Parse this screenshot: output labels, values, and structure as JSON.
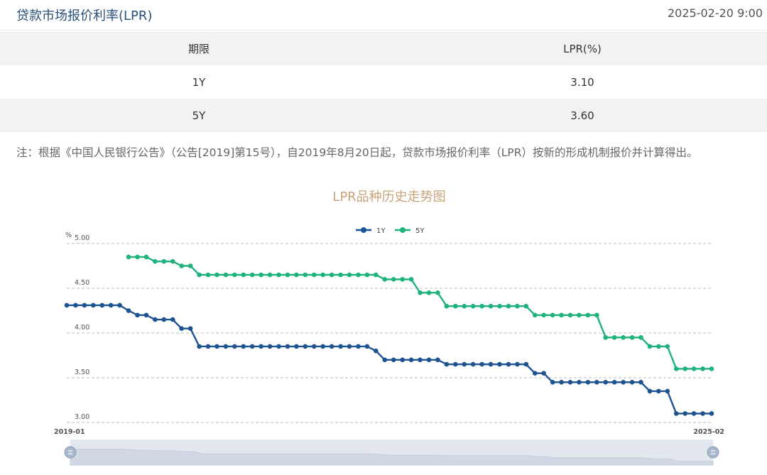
{
  "header": {
    "title": "贷款市场报价利率(LPR)",
    "date": "2025-02-20 9:00"
  },
  "table": {
    "columns": [
      "期限",
      "LPR(%)"
    ],
    "rows": [
      {
        "term": "1Y",
        "value": "3.10"
      },
      {
        "term": "5Y",
        "value": "3.60"
      }
    ]
  },
  "note": "注：根据《中国人民银行公告》（公告[2019]第15号），自2019年8月20日起，贷款市场报价利率（LPR）按新的形成机制报价并计算得出。",
  "chart_data": {
    "type": "line",
    "title": "LPR品种历史走势图",
    "ylabel": "%",
    "ylim": [
      3.0,
      5.0
    ],
    "yticks": [
      "5.00",
      "4.50",
      "4.00",
      "3.50",
      "3.00"
    ],
    "x_start_label": "2019-01",
    "x_end_label": "2025-02",
    "legend_position": "top-center",
    "grid": true,
    "series": [
      {
        "name": "1Y",
        "color": "#1d5390",
        "values": [
          4.31,
          4.31,
          4.31,
          4.31,
          4.31,
          4.31,
          4.31,
          4.25,
          4.2,
          4.2,
          4.15,
          4.15,
          4.15,
          4.05,
          4.05,
          3.85,
          3.85,
          3.85,
          3.85,
          3.85,
          3.85,
          3.85,
          3.85,
          3.85,
          3.85,
          3.85,
          3.85,
          3.85,
          3.85,
          3.85,
          3.85,
          3.85,
          3.85,
          3.85,
          3.85,
          3.8,
          3.7,
          3.7,
          3.7,
          3.7,
          3.7,
          3.7,
          3.7,
          3.65,
          3.65,
          3.65,
          3.65,
          3.65,
          3.65,
          3.65,
          3.65,
          3.65,
          3.65,
          3.55,
          3.55,
          3.45,
          3.45,
          3.45,
          3.45,
          3.45,
          3.45,
          3.45,
          3.45,
          3.45,
          3.45,
          3.45,
          3.35,
          3.35,
          3.35,
          3.1,
          3.1,
          3.1,
          3.1,
          3.1
        ]
      },
      {
        "name": "5Y",
        "color": "#1fb27a",
        "start_index": 7,
        "values": [
          4.85,
          4.85,
          4.85,
          4.8,
          4.8,
          4.8,
          4.75,
          4.75,
          4.65,
          4.65,
          4.65,
          4.65,
          4.65,
          4.65,
          4.65,
          4.65,
          4.65,
          4.65,
          4.65,
          4.65,
          4.65,
          4.65,
          4.65,
          4.65,
          4.65,
          4.65,
          4.65,
          4.65,
          4.65,
          4.6,
          4.6,
          4.6,
          4.6,
          4.45,
          4.45,
          4.45,
          4.3,
          4.3,
          4.3,
          4.3,
          4.3,
          4.3,
          4.3,
          4.3,
          4.3,
          4.3,
          4.2,
          4.2,
          4.2,
          4.2,
          4.2,
          4.2,
          4.2,
          4.2,
          3.95,
          3.95,
          3.95,
          3.95,
          3.95,
          3.85,
          3.85,
          3.85,
          3.6,
          3.6,
          3.6,
          3.6,
          3.6
        ]
      }
    ]
  }
}
